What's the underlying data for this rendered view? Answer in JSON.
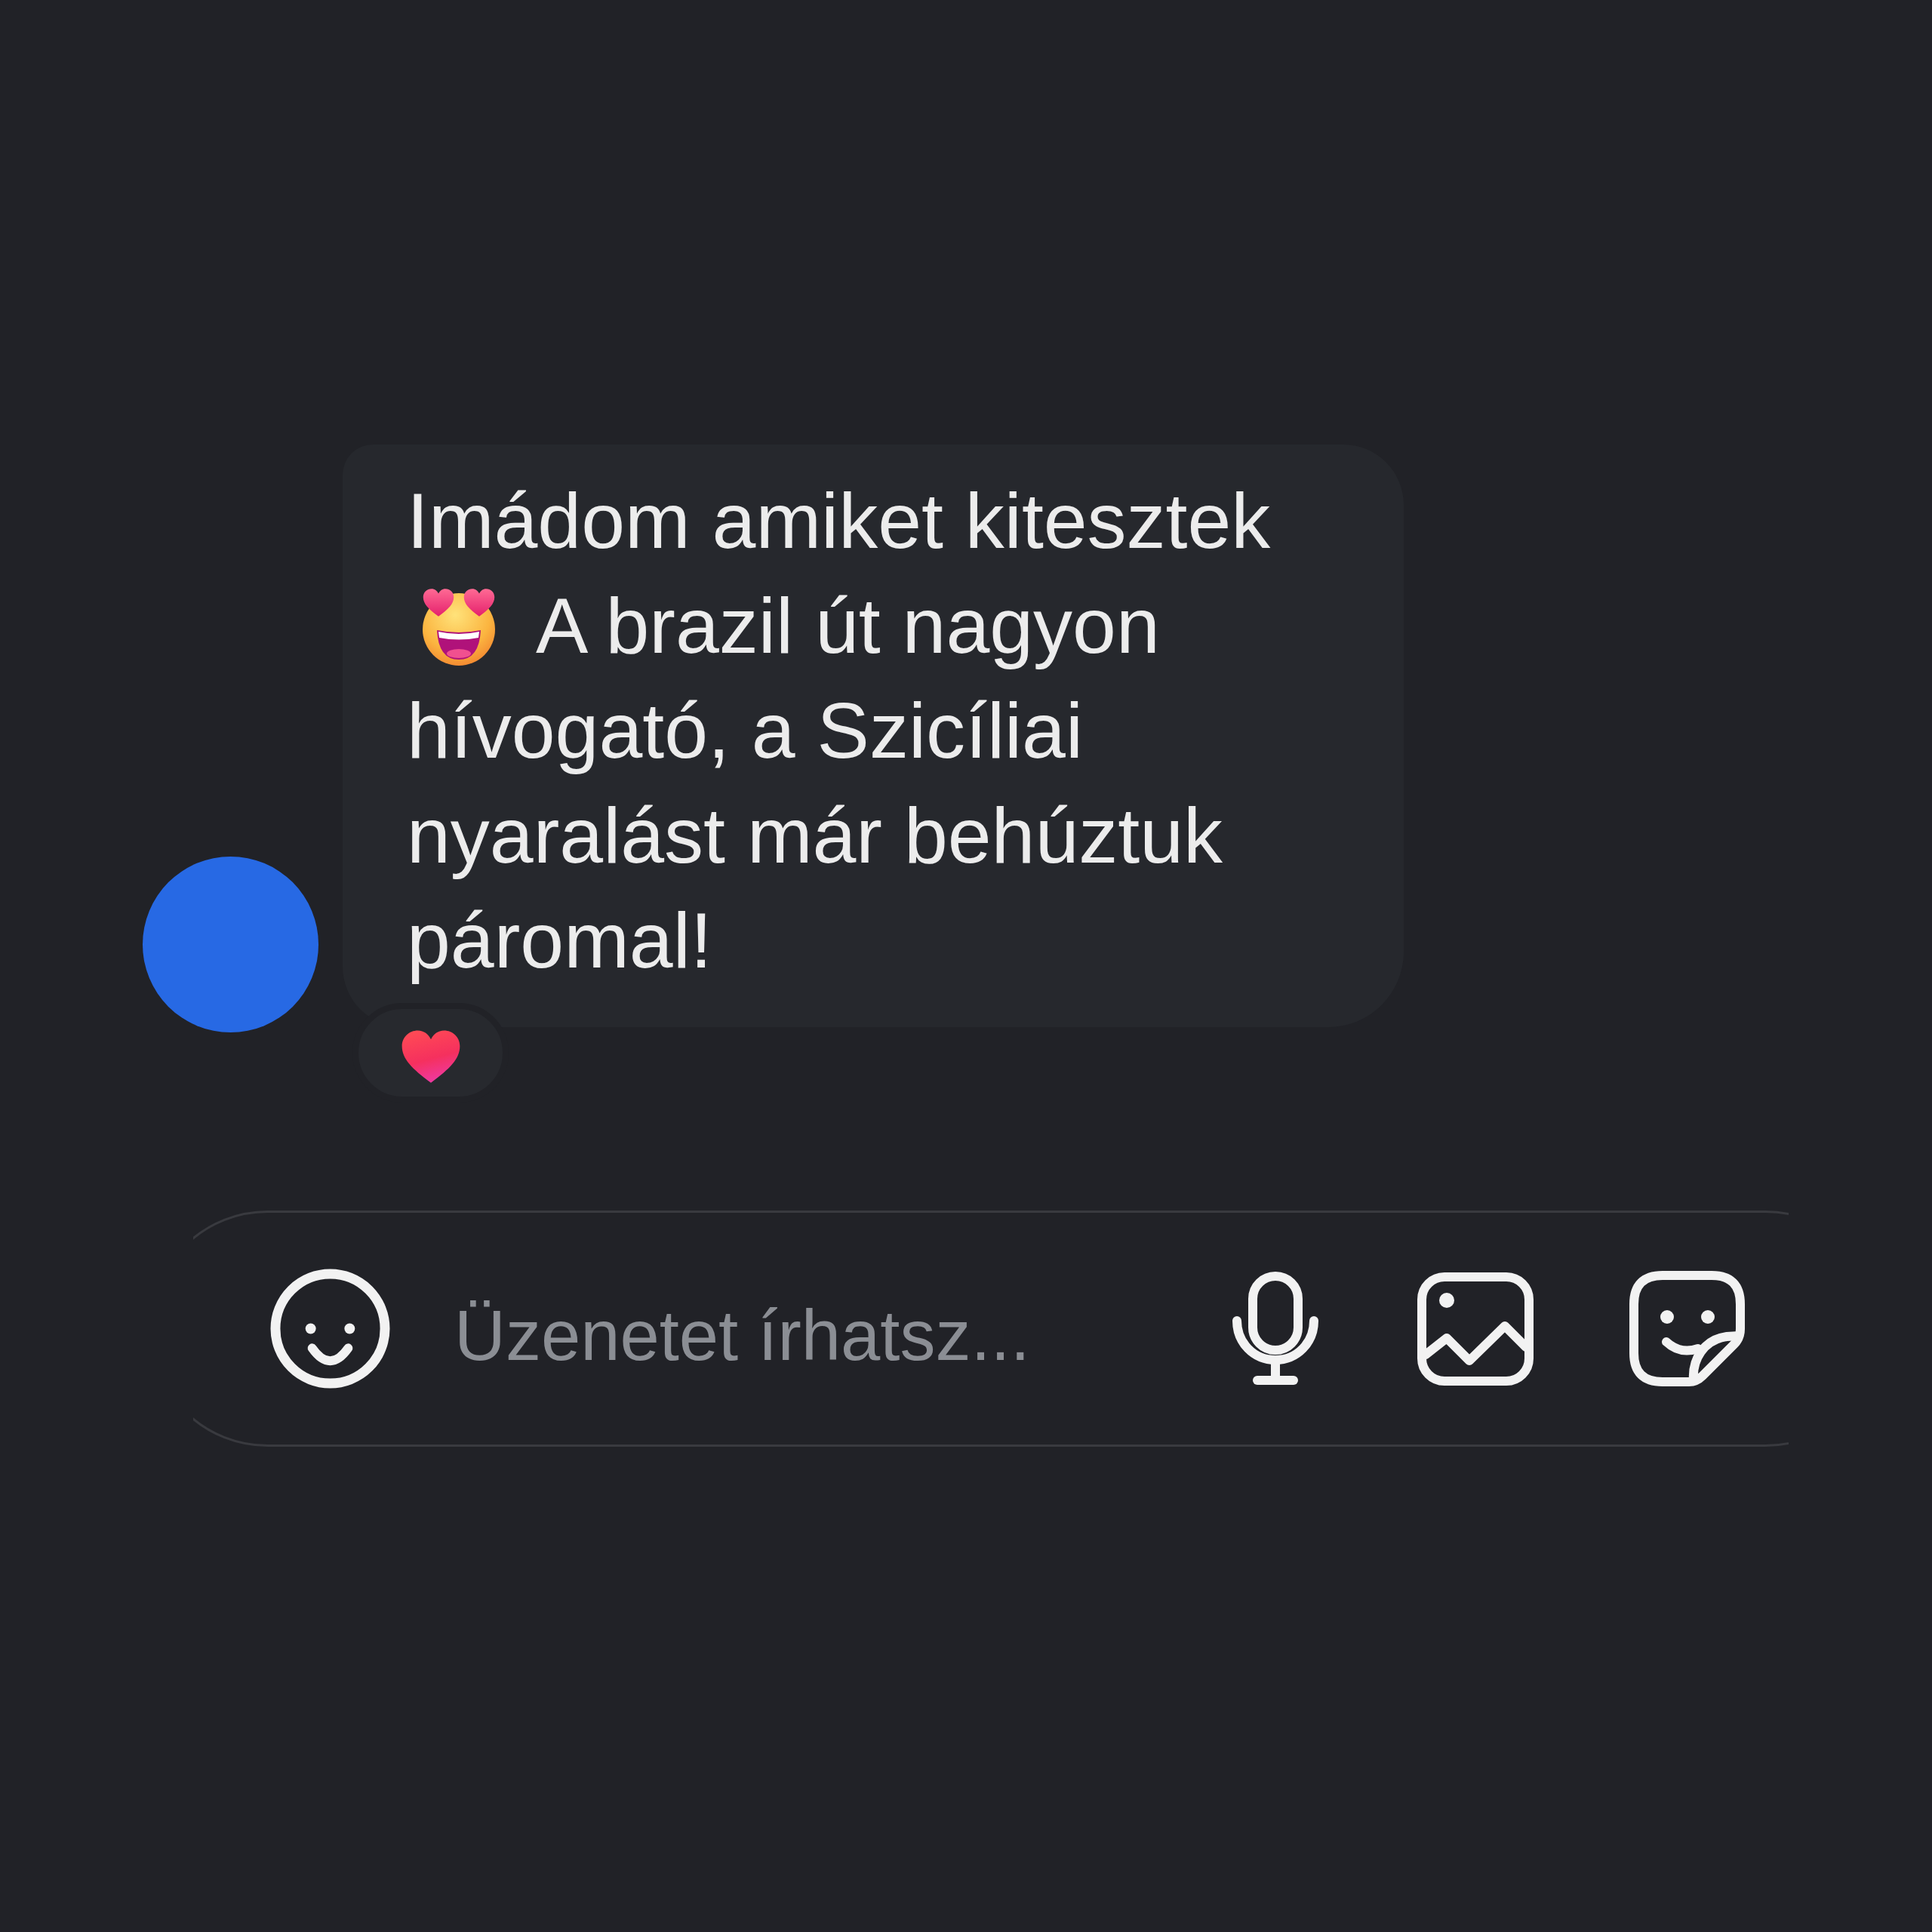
{
  "message": {
    "lines": [
      {
        "leading_emoji": false,
        "text": "Imádom amiket kitesztek"
      },
      {
        "leading_emoji": true,
        "text": "A brazil út nagyon"
      },
      {
        "leading_emoji": false,
        "text": "hívogató, a Szicíliai"
      },
      {
        "leading_emoji": false,
        "text": "nyaralást már behúztuk"
      },
      {
        "leading_emoji": false,
        "text": "páromal!"
      }
    ],
    "reactions": [
      {
        "kind": "heart"
      }
    ]
  },
  "composer": {
    "placeholder": "Üzenetet írhatsz..."
  }
}
